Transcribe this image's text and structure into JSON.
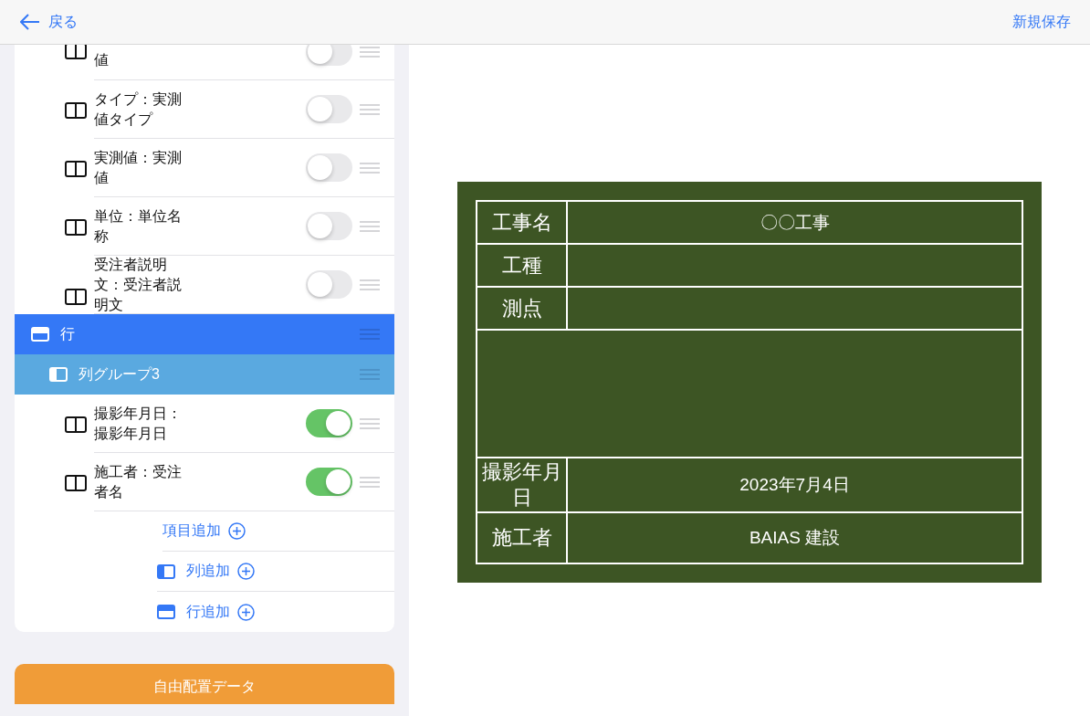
{
  "header": {
    "back": "戻る",
    "save": "新規保存"
  },
  "list": [
    {
      "kind": "field",
      "label": "値",
      "on": false,
      "partial": true
    },
    {
      "kind": "field",
      "label": "タイプ：実測値タイプ",
      "on": false,
      "partial": false
    },
    {
      "kind": "field",
      "label": "実測値：実測値",
      "on": false,
      "partial": false
    },
    {
      "kind": "field",
      "label": "単位：単位名称",
      "on": false,
      "partial": false
    },
    {
      "kind": "field",
      "label": "受注者説明文：受注者説明文",
      "on": false,
      "partial": false
    },
    {
      "kind": "row",
      "label": "行"
    },
    {
      "kind": "column",
      "label": "列グループ3"
    },
    {
      "kind": "field",
      "label": "撮影年月日：撮影年月日",
      "on": true,
      "partial": false
    },
    {
      "kind": "field",
      "label": "施工者：受注者名",
      "on": true,
      "partial": false
    }
  ],
  "add_actions": [
    {
      "kind": "item",
      "label": "項目追加"
    },
    {
      "kind": "column",
      "label": "列追加"
    },
    {
      "kind": "row",
      "label": "行追加"
    }
  ],
  "bottom_button": "自由配置データ",
  "board": [
    {
      "kind": "pair",
      "label": "工事名",
      "value": "〇〇工事"
    },
    {
      "kind": "pair",
      "label": "工種"
    },
    {
      "kind": "pair",
      "label": "測点"
    },
    {
      "kind": "blank"
    },
    {
      "kind": "pair",
      "label": "撮影年月日",
      "value": "2023年7月4日"
    },
    {
      "kind": "pair",
      "label": "施工者",
      "value": "BAIAS 建設"
    }
  ]
}
